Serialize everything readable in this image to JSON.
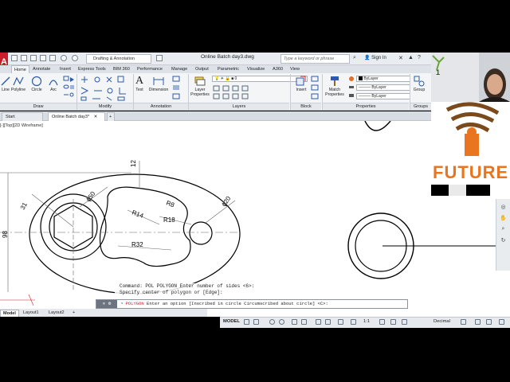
{
  "titlebar": {
    "workspace": "Drafting & Annotation",
    "title": "Online Batch day3.dwg",
    "search_placeholder": "Type a keyword or phrase",
    "signin": "Sign In"
  },
  "ribbon_tabs": [
    "Home",
    "Annotate",
    "Insert",
    "Express Tools",
    "BIM 360",
    "Performance",
    "Manage",
    "Output",
    "Parametric",
    "Visualize",
    "A360",
    "View"
  ],
  "draw": {
    "line": "Line",
    "polyline": "Polyline",
    "circle": "Circle",
    "arc": "Arc",
    "panel": "Draw"
  },
  "modify": {
    "panel": "Modify"
  },
  "annotation": {
    "text": "Text",
    "dimension": "Dimension",
    "panel": "Annotation"
  },
  "layers": {
    "layer_properties": "Layer Properties",
    "current_layer": "0",
    "panel": "Layers"
  },
  "block": {
    "insert": "Insert",
    "panel": "Block"
  },
  "properties": {
    "match": "Match Properties",
    "color": "ByLayer",
    "linetype": "ByLayer",
    "lineweight": "ByLayer",
    "panel": "Properties"
  },
  "groups": {
    "group": "Group",
    "panel": "Groups"
  },
  "file_tabs": {
    "start": "Start",
    "active": "Online Batch day3*"
  },
  "viewport_label": "[-][Top][2D Wireframe]",
  "dimensions": {
    "d12": "12",
    "d31": "31",
    "phi50": "ϕ50",
    "phi20": "ϕ20",
    "r8": "R8",
    "r14": "R14",
    "r18": "R18",
    "r32": "R32",
    "d98": "98"
  },
  "command": {
    "history1": "Command: POL POLYGON Enter number of sides <6>:",
    "history2": "Specify center of polygon or [Edge]:",
    "prompt_cmd": "POLYGON",
    "prompt_text": "Enter an option [Inscribed in circle Circumscribed about circle] <C>:"
  },
  "layout_tabs": [
    "Model",
    "Layout1",
    "Layout2"
  ],
  "status": {
    "model": "MODEL",
    "units": "Decimal",
    "scale": "1:1"
  },
  "logo": {
    "text": "FUTURE"
  },
  "colors": {
    "logo_orange": "#e9761e",
    "logo_brown": "#7a4a1c",
    "autocad_red": "#c8202a"
  }
}
